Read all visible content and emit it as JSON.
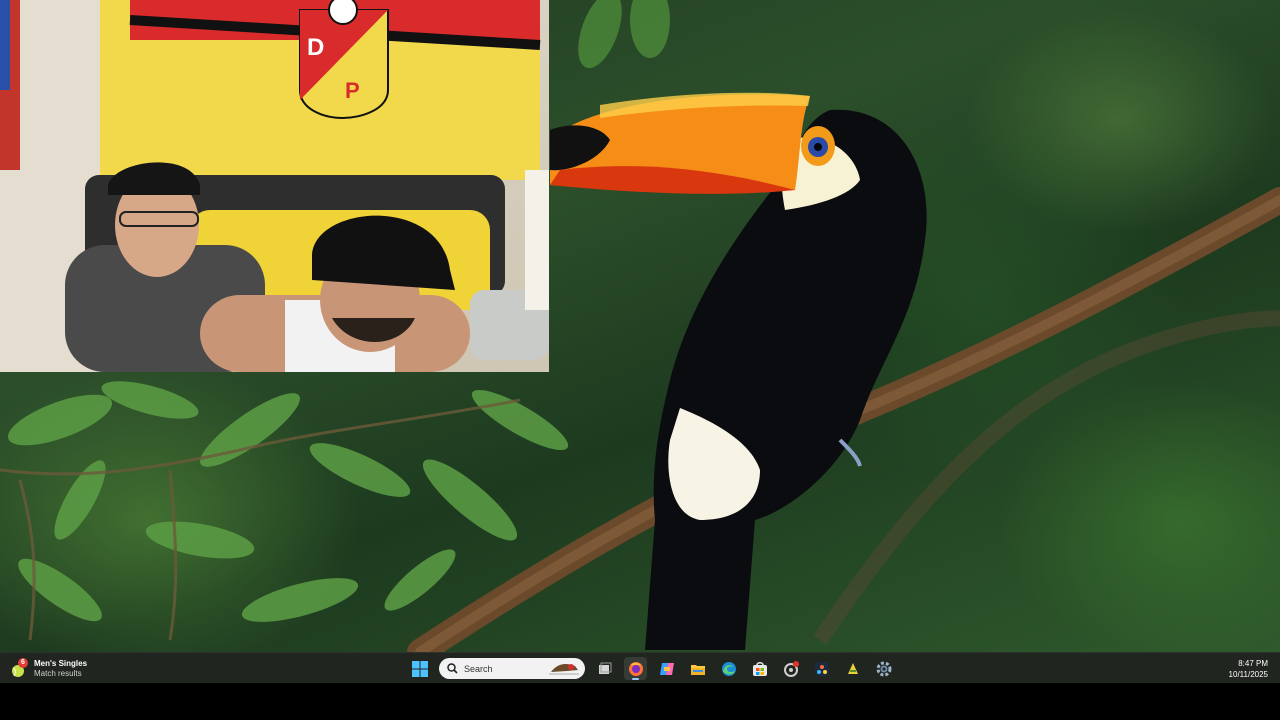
{
  "widget": {
    "badge": "6",
    "title": "Men's Singles",
    "subtitle": "Match results",
    "icon": "tennis-ball-icon"
  },
  "taskbar": {
    "search_placeholder": "Search",
    "apps": [
      {
        "name": "start",
        "icon": "windows-logo-icon"
      },
      {
        "name": "task-view",
        "icon": "task-view-icon"
      },
      {
        "name": "firefox",
        "icon": "firefox-icon",
        "active": true
      },
      {
        "name": "copilot",
        "icon": "copilot-icon"
      },
      {
        "name": "file-explorer",
        "icon": "folder-icon"
      },
      {
        "name": "edge",
        "icon": "edge-icon"
      },
      {
        "name": "microsoft-store",
        "icon": "store-icon"
      },
      {
        "name": "app-badged",
        "icon": "circular-app-icon"
      },
      {
        "name": "davinci",
        "icon": "editor-icon"
      },
      {
        "name": "app-yellow",
        "icon": "yellow-app-icon"
      },
      {
        "name": "settings",
        "icon": "gear-icon"
      }
    ]
  },
  "clock": {
    "time": "8:47 PM",
    "date": "10/11/2025"
  },
  "colors": {
    "taskbar_bg": "#20251f",
    "accent": "#9ec6ff",
    "flag_yellow": "#f2d94c",
    "flag_red": "#d92b2b"
  }
}
